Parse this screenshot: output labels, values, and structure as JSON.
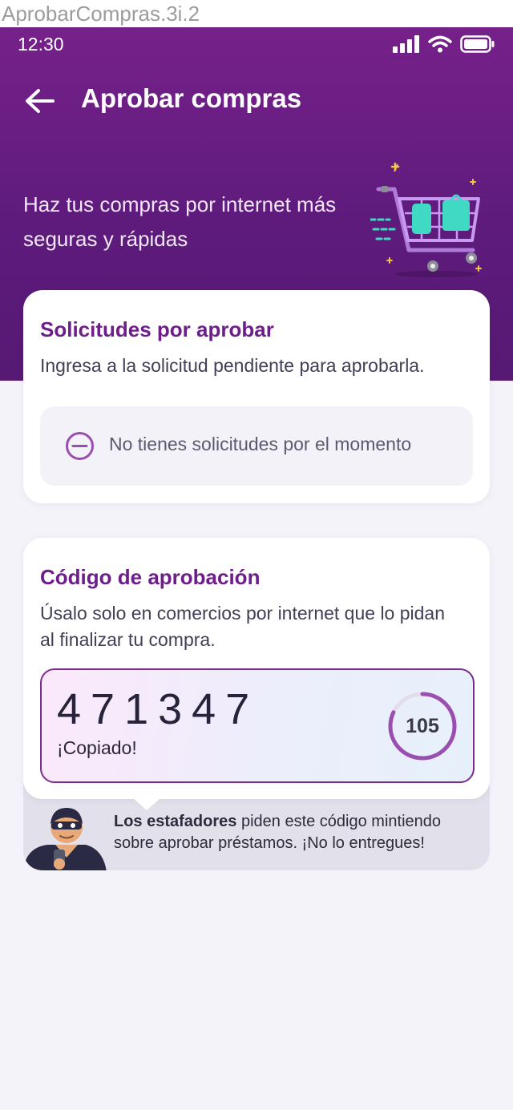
{
  "frame_caption": "AprobarCompras.3i.2",
  "status_bar": {
    "time": "12:30",
    "icons": [
      "signal-icon",
      "wifi-icon",
      "battery-icon"
    ]
  },
  "header": {
    "title": "Aprobar compras",
    "tagline": "Haz tus compras por internet más seguras y rápidas",
    "illustration": "shopping-cart-icon"
  },
  "requests_card": {
    "title": "Solicitudes por aprobar",
    "description": "Ingresa a la solicitud pendiente para aprobarla.",
    "empty_message": "No tienes solicitudes por el momento",
    "empty_icon": "minus-circle-icon"
  },
  "code_card": {
    "title": "Código de aprobación",
    "description": "Úsalo solo en comercios por internet que lo pidan al finalizar tu compra.",
    "code": "471347",
    "copy_status": "¡Copiado!",
    "timer_seconds": "105",
    "timer_progress": 0.82
  },
  "warning": {
    "bold": "Los estafadores",
    "text": " piden este código mintiendo sobre aprobar préstamos. ¡No lo entregues!"
  },
  "colors": {
    "header_top": "#76218a",
    "header_bottom": "#561a73",
    "accent": "#6e1e8a",
    "ring": "#9a4eb0",
    "background": "#f4f3f9"
  }
}
